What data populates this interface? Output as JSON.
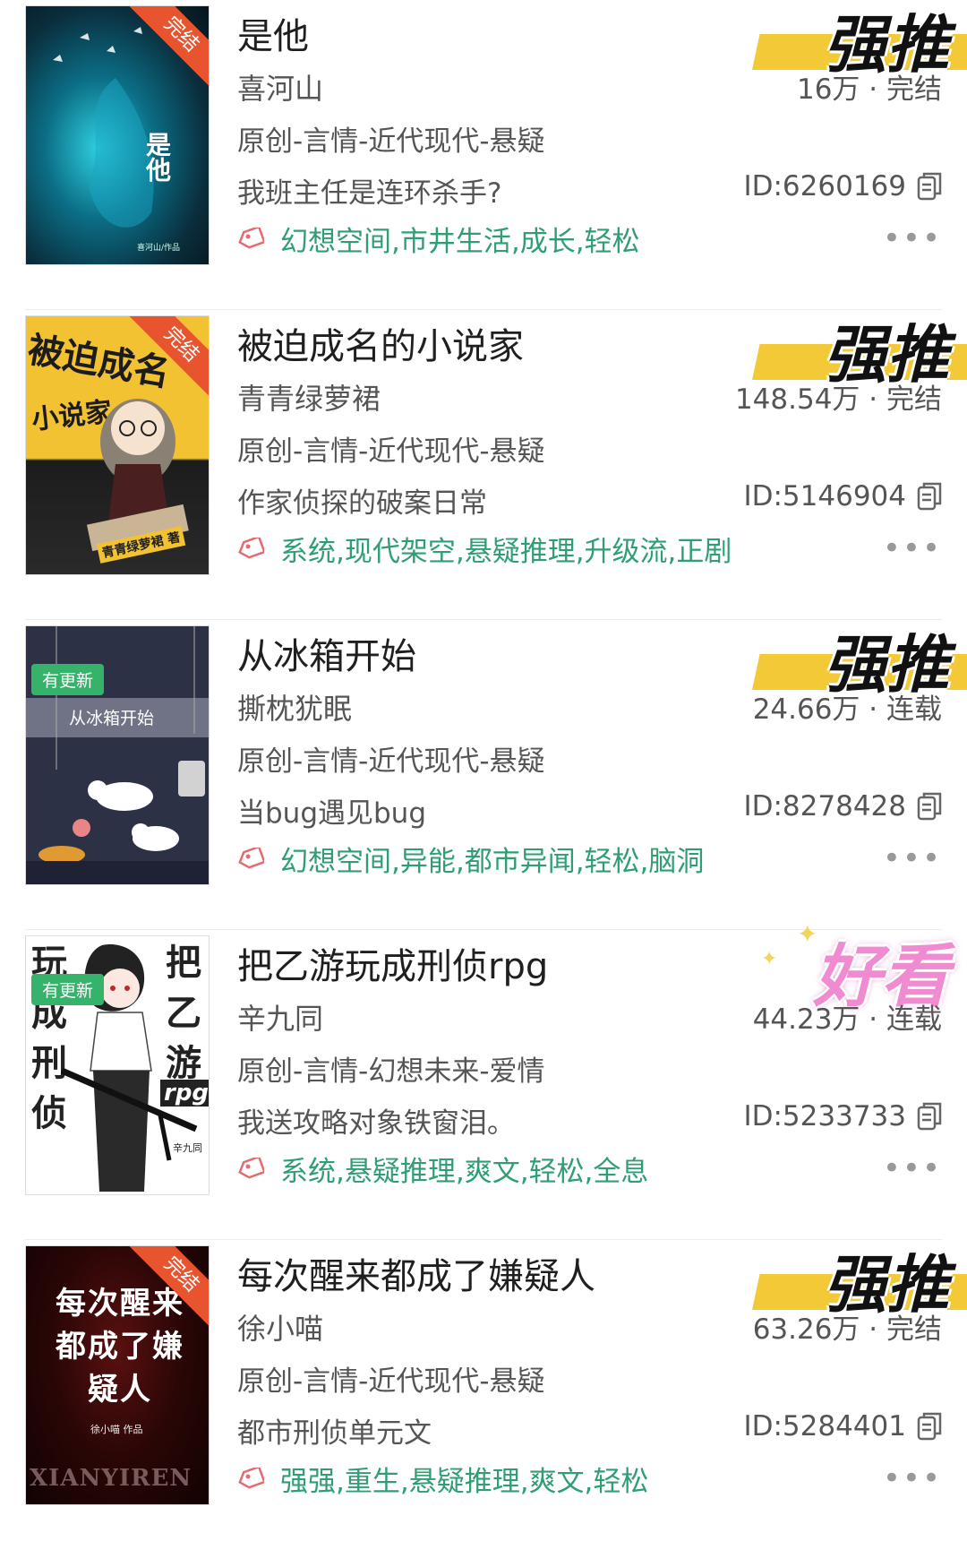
{
  "books": [
    {
      "title": "是他",
      "author": "喜河山",
      "genre": "原创-言情-近代现代-悬疑",
      "intro": "我班主任是连环杀手?",
      "tags": "幻想空间,市井生活,成长,轻松",
      "stat": "16万 · 完结",
      "id": "ID:6260169",
      "ribbon": "强推",
      "cover_badge": "完结",
      "cover_title": "是他",
      "cover_author": "喜河山/作品"
    },
    {
      "title": "被迫成名的小说家",
      "author": "青青绿萝裙",
      "genre": "原创-言情-近代现代-悬疑",
      "intro": "作家侦探的破案日常",
      "tags": "系统,现代架空,悬疑推理,升级流,正剧",
      "stat": "148.54万 · 完结",
      "id": "ID:5146904",
      "ribbon": "强推",
      "cover_badge": "完结",
      "cover_title": "被迫成名",
      "cover_subtitle": "小说家",
      "cover_author": "青青绿萝裙 著"
    },
    {
      "title": "从冰箱开始",
      "author": "撕枕犹眠",
      "genre": "原创-言情-近代现代-悬疑",
      "intro": "当bug遇见bug",
      "tags": "幻想空间,异能,都市异闻,轻松,脑洞",
      "stat": "24.66万 · 连载",
      "id": "ID:8278428",
      "ribbon": "强推",
      "cover_badge": "有更新",
      "cover_title": "从冰箱开始"
    },
    {
      "title": "把乙游玩成刑侦rpg",
      "author": "辛九同",
      "genre": "原创-言情-幻想未来-爱情",
      "intro": "我送攻略对象铁窗泪。",
      "tags": "系统,悬疑推理,爽文,轻松,全息",
      "stat": "44.23万 · 连载",
      "id": "ID:5233733",
      "ribbon": "好看",
      "cover_badge": "有更新",
      "cover_title_left": "玩成刑侦",
      "cover_title_right": "把乙游",
      "cover_rpg": "rpg",
      "cover_author": "辛九同"
    },
    {
      "title": "每次醒来都成了嫌疑人",
      "author": "徐小喵",
      "genre": "原创-言情-近代现代-悬疑",
      "intro": "都市刑侦单元文",
      "tags": "强强,重生,悬疑推理,爽文,轻松",
      "stat": "63.26万 · 完结",
      "id": "ID:5284401",
      "ribbon": "强推",
      "cover_badge": "完结",
      "cover_title": "每次醒来都成了嫌疑人",
      "cover_footer": "XIANYIREN",
      "cover_author": "徐小喵 作品"
    }
  ],
  "more_label": "•••",
  "colors": {
    "tag_green": "#2f9e73",
    "badge_orange": "#e8542e",
    "ribbon_yellow": "#f4c938",
    "update_green": "#35b36a"
  }
}
